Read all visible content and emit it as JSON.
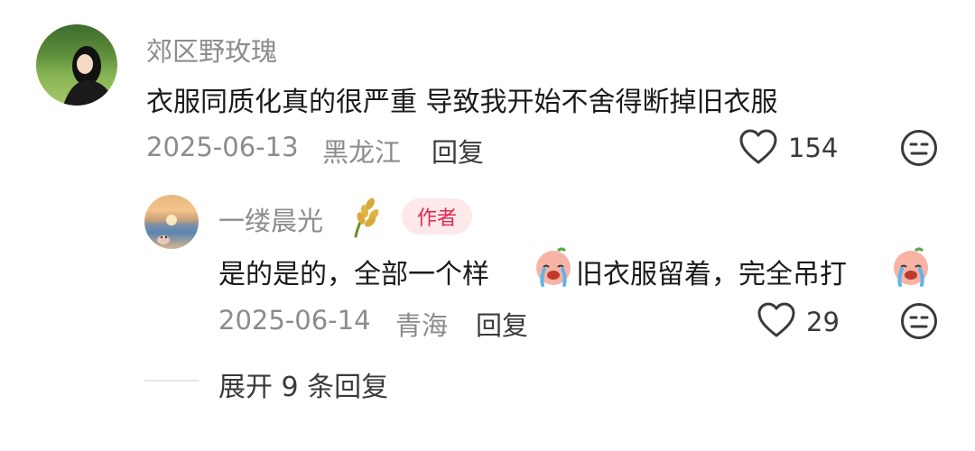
{
  "comment": {
    "username": "郊区野玫瑰",
    "text": "衣服同质化真的很严重 导致我开始不舍得断掉旧衣服",
    "date": "2025-06-13",
    "location": "黑龙江",
    "reply_label": "回复",
    "like_count": "154"
  },
  "reply": {
    "username": "一缕晨光",
    "author_badge": "作者",
    "text_part1": "是的是的，全部一个样",
    "text_part2": "旧衣服留着，完全吊打",
    "date": "2025-06-14",
    "location": "青海",
    "reply_label": "回复",
    "like_count": "29"
  },
  "expand_label": "展开 9 条回复",
  "colors": {
    "badge_bg": "#fde8ea",
    "badge_text": "#e0284e",
    "muted_text": "#8c8c8c"
  },
  "icons": {
    "like": "heart-outline-icon",
    "dislike": "meh-face-icon",
    "name_decoration": "rice-ear-icon",
    "emoji": "crying-face-emoji"
  }
}
